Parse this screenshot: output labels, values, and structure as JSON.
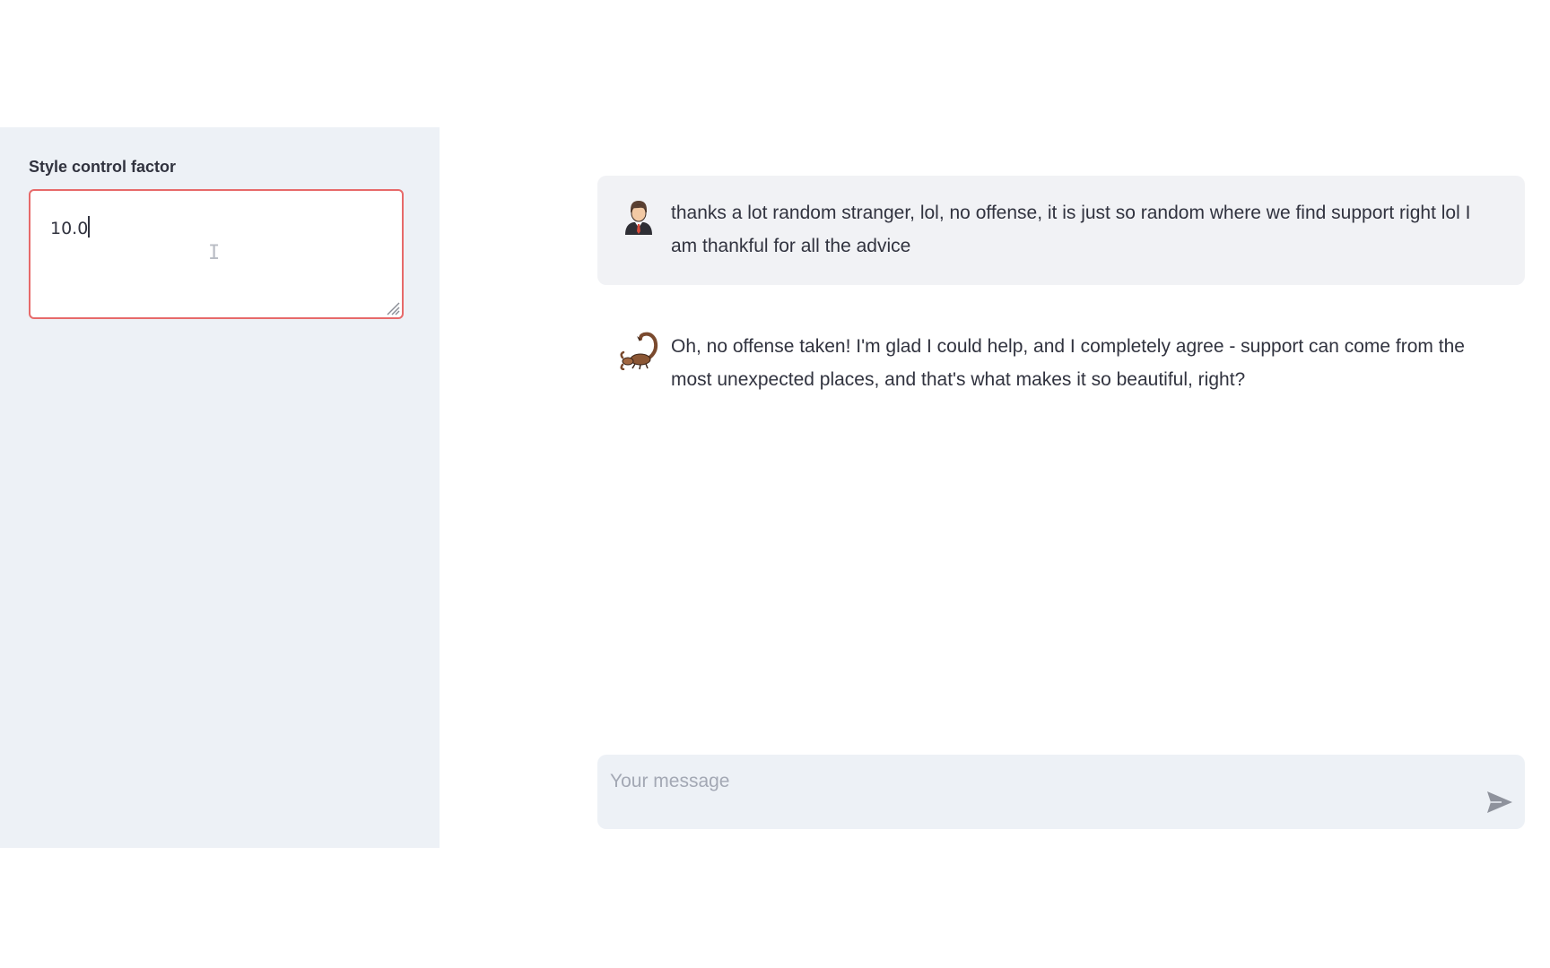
{
  "sidebar": {
    "style_control": {
      "label": "Style control factor",
      "value": "10.0"
    }
  },
  "chat": {
    "messages": [
      {
        "role": "user",
        "avatar_icon": "user-avatar-icon",
        "text": "thanks a lot random stranger, lol, no offense, it is just so random where we find support right lol I am thankful for all the advice"
      },
      {
        "role": "assistant",
        "avatar_icon": "scorpion-avatar-icon",
        "text": "Oh, no offense taken! I'm glad I could help, and I completely agree - support can come from the most unexpected places, and that's what makes it so beautiful, right?"
      }
    ],
    "input": {
      "placeholder": "Your message",
      "value": "",
      "send_icon": "send-icon"
    }
  },
  "colors": {
    "sidebar_bg": "#edf1f6",
    "focus_border": "#e76a6a",
    "user_bubble_bg": "#f1f2f5",
    "text": "#31333f"
  }
}
